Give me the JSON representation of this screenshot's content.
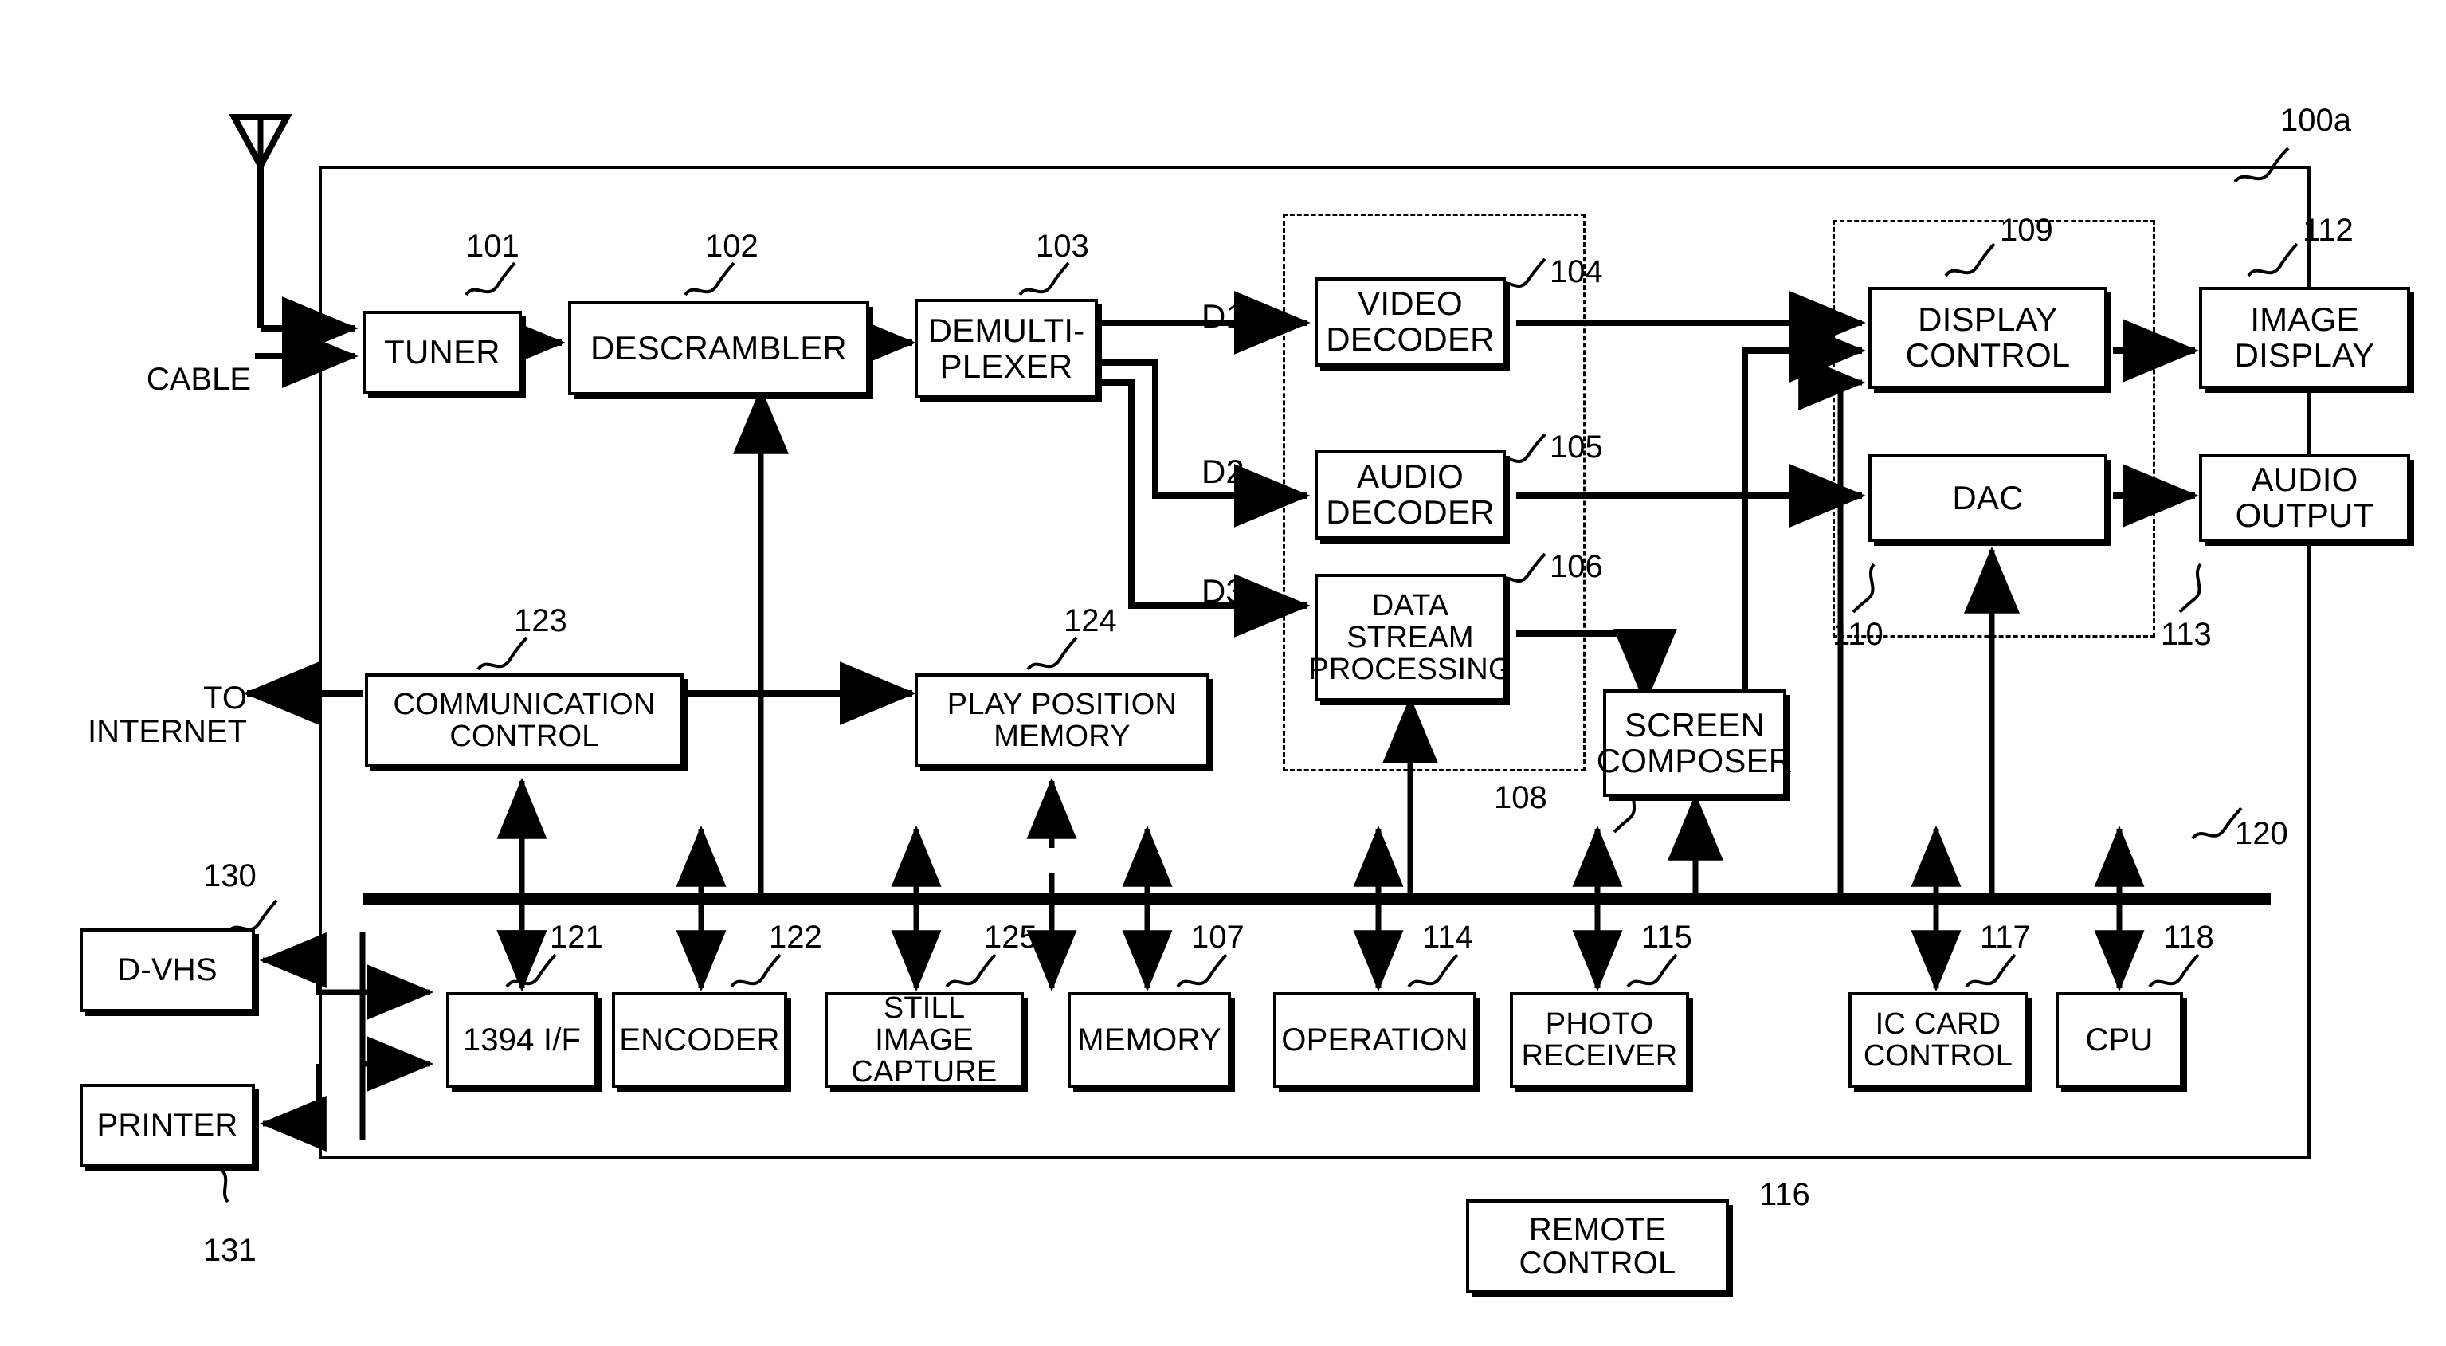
{
  "figure": {
    "device_ref": "100a",
    "bus_ref": "120",
    "group_ref_decoders": "108"
  },
  "external_labels": {
    "cable": "CABLE",
    "to_internet": "TO\nINTERNET"
  },
  "signal_labels": {
    "d1": "D1",
    "d2": "D2",
    "d3": "D3"
  },
  "blocks": [
    {
      "id": "tuner",
      "label": "TUNER",
      "ref": "101"
    },
    {
      "id": "descrambler",
      "label": "DESCRAMBLER",
      "ref": "102"
    },
    {
      "id": "demultiplexer",
      "label": "DEMULTI-\nPLEXER",
      "ref": "103"
    },
    {
      "id": "video-decoder",
      "label": "VIDEO\nDECODER",
      "ref": "104"
    },
    {
      "id": "audio-decoder",
      "label": "AUDIO\nDECODER",
      "ref": "105"
    },
    {
      "id": "data-stream",
      "label": "DATA\nSTREAM\nPROCESSING",
      "ref": "106"
    },
    {
      "id": "memory",
      "label": "MEMORY",
      "ref": "107"
    },
    {
      "id": "display-control",
      "label": "DISPLAY\nCONTROL",
      "ref": "109"
    },
    {
      "id": "dac",
      "label": "DAC",
      "ref": "110"
    },
    {
      "id": "image-display",
      "label": "IMAGE\nDISPLAY",
      "ref": "112"
    },
    {
      "id": "audio-output",
      "label": "AUDIO\nOUTPUT",
      "ref": "113"
    },
    {
      "id": "operation",
      "label": "OPERATION",
      "ref": "114"
    },
    {
      "id": "photo-receiver",
      "label": "PHOTO\nRECEIVER",
      "ref": "115"
    },
    {
      "id": "remote-control",
      "label": "REMOTE\nCONTROL",
      "ref": "116"
    },
    {
      "id": "ic-card-control",
      "label": "IC CARD\nCONTROL",
      "ref": "117"
    },
    {
      "id": "cpu",
      "label": "CPU",
      "ref": "118"
    },
    {
      "id": "1394-if",
      "label": "1394 I/F",
      "ref": "121"
    },
    {
      "id": "encoder",
      "label": "ENCODER",
      "ref": "122"
    },
    {
      "id": "communication-control",
      "label": "COMMUNICATION\nCONTROL",
      "ref": "123"
    },
    {
      "id": "play-position-memory",
      "label": "PLAY POSITION\nMEMORY",
      "ref": "124"
    },
    {
      "id": "still-image-capture",
      "label": "STILL IMAGE\nCAPTURE",
      "ref": "125"
    },
    {
      "id": "screen-composer",
      "label": "SCREEN\nCOMPOSER",
      "ref": ""
    },
    {
      "id": "d-vhs",
      "label": "D-VHS",
      "ref": "130"
    },
    {
      "id": "printer",
      "label": "PRINTER",
      "ref": "131"
    }
  ]
}
